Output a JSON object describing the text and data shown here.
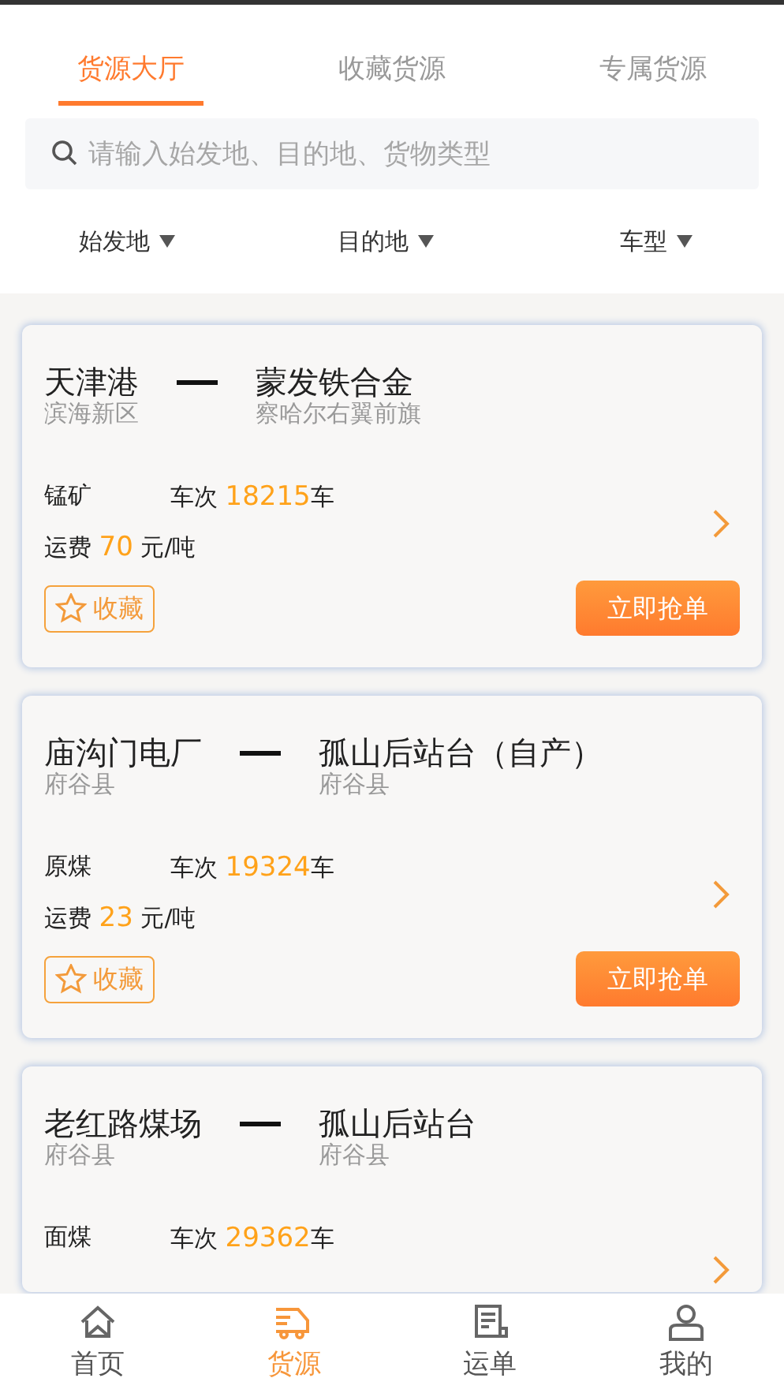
{
  "tabs": [
    {
      "label": "货源大厅",
      "selected": true
    },
    {
      "label": "收藏货源",
      "selected": false
    },
    {
      "label": "专属货源",
      "selected": false
    }
  ],
  "search": {
    "placeholder": "请输入始发地、目的地、货物类型"
  },
  "filters": [
    {
      "label": "始发地"
    },
    {
      "label": "目的地"
    },
    {
      "label": "车型"
    }
  ],
  "cards": [
    {
      "origin": "天津港",
      "origin_area": "滨海新区",
      "destination": "蒙发铁合金",
      "destination_area": "察哈尔右翼前旗",
      "cargo": "锰矿",
      "trips_label": "车次",
      "trips": "18215",
      "trips_unit": "车",
      "fee_label": "运费",
      "fee": "70",
      "fee_unit": "元/吨",
      "favorite": "收藏",
      "grab": "立即抢单"
    },
    {
      "origin": "庙沟门电厂",
      "origin_area": "府谷县",
      "destination": "孤山后站台（自产）",
      "destination_area": "府谷县",
      "cargo": "原煤",
      "trips_label": "车次",
      "trips": "19324",
      "trips_unit": "车",
      "fee_label": "运费",
      "fee": "23",
      "fee_unit": "元/吨",
      "favorite": "收藏",
      "grab": "立即抢单"
    },
    {
      "origin": "老红路煤场",
      "origin_area": "府谷县",
      "destination": "孤山后站台",
      "destination_area": "府谷县",
      "cargo": "面煤",
      "trips_label": "车次",
      "trips": "29362",
      "trips_unit": "车"
    }
  ],
  "nav": [
    {
      "label": "首页",
      "kind": "home",
      "selected": false
    },
    {
      "label": "货源",
      "kind": "cargo",
      "selected": true
    },
    {
      "label": "运单",
      "kind": "waybill",
      "selected": false
    },
    {
      "label": "我的",
      "kind": "profile",
      "selected": false
    }
  ]
}
